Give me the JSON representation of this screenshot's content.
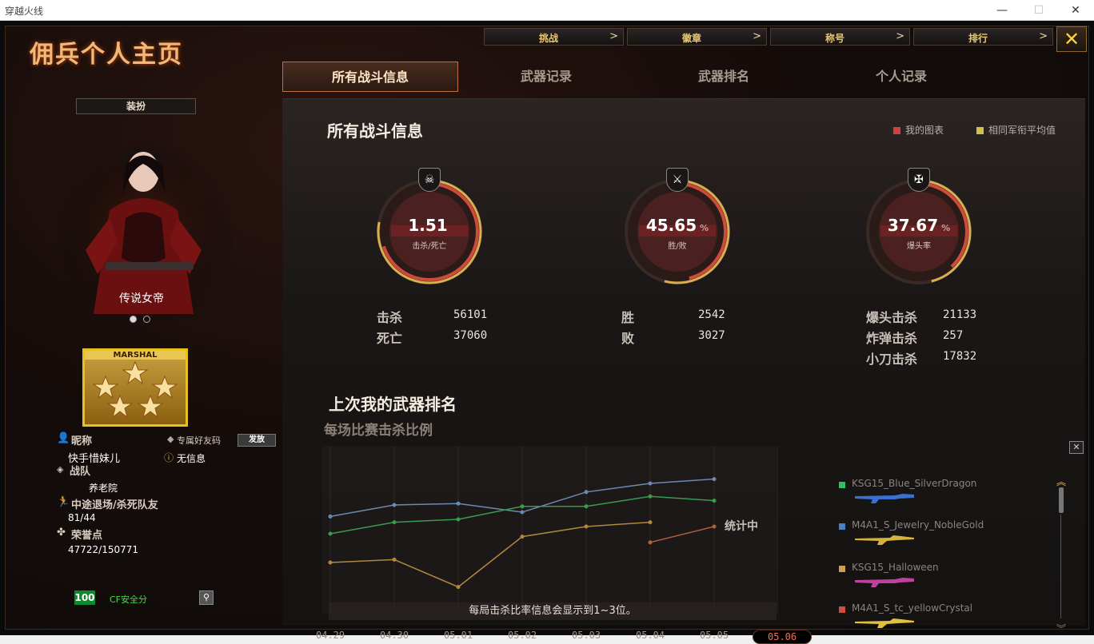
{
  "window": {
    "title": "穿越火线",
    "min": "—",
    "max": "☐",
    "close": "✕"
  },
  "page_title": "佣兵个人主页",
  "topnav": [
    {
      "label": "挑战",
      "arrow": ">"
    },
    {
      "label": "徽章",
      "arrow": ">"
    },
    {
      "label": "称号",
      "arrow": ">"
    },
    {
      "label": "排行",
      "arrow": ">"
    }
  ],
  "close_label": "✕",
  "tabs": [
    "所有战斗信息",
    "武器记录",
    "武器排名",
    "个人记录"
  ],
  "left": {
    "dress_button": "装扮",
    "character_name": "传说女帝",
    "rank_text": "MARSHAL",
    "nickname_label": "昵称",
    "nickname": "快手惜妹儿",
    "friend_code_label": "专属好友码",
    "send_label": "发放",
    "no_info": "无信息",
    "team_label": "战队",
    "team": "养老院",
    "quit_label": "中途退场/杀死队友",
    "quit_value": "81/44",
    "honor_label": "荣誉点",
    "honor_value": "47722/150771",
    "safe_score": "100",
    "safe_label": "CF安全分"
  },
  "battle": {
    "title": "所有战斗信息",
    "legend_mine": "我的图表",
    "legend_avg": "相同军衔平均值",
    "legend_colors": [
      "#d04040",
      "#d0c050"
    ],
    "rings": [
      {
        "value": "1.51",
        "pct": "",
        "caption": "击杀/死亡",
        "icon": "skull-icon",
        "icon_glyph": "☠",
        "fraction": 0.7
      },
      {
        "value": "45.65",
        "pct": "%",
        "caption": "胜/败",
        "icon": "crossed-guns-icon",
        "icon_glyph": "⚔",
        "fraction": 0.46
      },
      {
        "value": "37.67",
        "pct": "%",
        "caption": "爆头率",
        "icon": "rifle-icon",
        "icon_glyph": "✠",
        "fraction": 0.38
      }
    ],
    "kills_label": "击杀",
    "kills": "56101",
    "deaths_label": "死亡",
    "deaths": "37060",
    "wins_label": "胜",
    "wins": "2542",
    "losses_label": "败",
    "losses": "3027",
    "headshot_label": "爆头击杀",
    "headshot": "21133",
    "bomb_label": "炸弹击杀",
    "bomb": "257",
    "knife_label": "小刀击杀",
    "knife": "17832"
  },
  "weapon_rank": {
    "title": "上次我的武器排名",
    "chart_subtitle": "每场比赛击杀比例",
    "pending": "统计中",
    "note": "每局击杀比率信息会显示到1~3位。",
    "weapons": [
      {
        "name": "KSG15_Blue_SilverDragon",
        "color": "#30c060",
        "gun": "#3a70d0"
      },
      {
        "name": "M4A1_S_Jewelry_NobleGold",
        "color": "#4a80c0",
        "gun": "#d8b040"
      },
      {
        "name": "KSG15_Halloween",
        "color": "#d0a050",
        "gun": "#c040a0"
      },
      {
        "name": "M4A1_S_tc_yellowCrystal",
        "color": "#d05040",
        "gun": "#e0c040"
      }
    ]
  },
  "chart_data": {
    "type": "line",
    "title": "每场比赛击杀比例",
    "categories": [
      "04.29",
      "04.30",
      "05.01",
      "05.02",
      "05.03",
      "05.04",
      "05.05",
      "05.06"
    ],
    "selected": "05.06",
    "series": [
      {
        "color": "#6a8ab0",
        "values": [
          0.62,
          0.7,
          0.71,
          0.65,
          0.79,
          0.85,
          0.88,
          null
        ]
      },
      {
        "color": "#3a9a50",
        "values": [
          0.5,
          0.58,
          0.6,
          0.69,
          0.69,
          0.76,
          0.73,
          null
        ]
      },
      {
        "color": "#b08840",
        "values": [
          0.3,
          0.32,
          0.13,
          0.48,
          0.55,
          0.58,
          null,
          null
        ]
      },
      {
        "color": "#b06040",
        "values": [
          null,
          null,
          null,
          null,
          null,
          0.44,
          0.55,
          null
        ]
      }
    ],
    "ylim": [
      0,
      1
    ],
    "grid": true
  }
}
